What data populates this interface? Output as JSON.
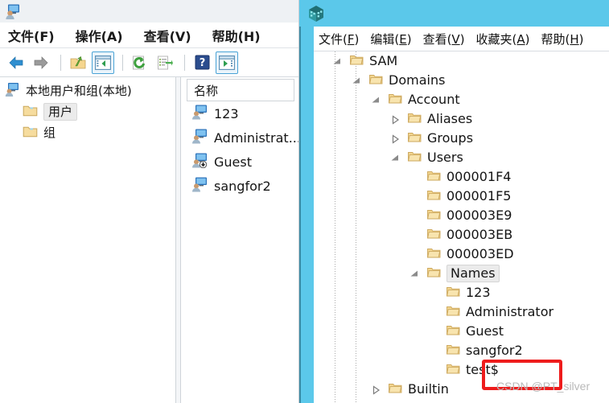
{
  "left_window": {
    "app_icon": "local-users-groups-icon",
    "menu": [
      {
        "label": "文件(F)"
      },
      {
        "label": "操作(A)"
      },
      {
        "label": "查看(V)"
      },
      {
        "label": "帮助(H)"
      }
    ],
    "toolbar": [
      {
        "name": "back-button",
        "icon": "left-arrow-icon"
      },
      {
        "name": "forward-button",
        "icon": "right-arrow-icon"
      },
      {
        "name": "up-folder-button",
        "icon": "up-folder-icon"
      },
      {
        "name": "show-hide-tree-button",
        "icon": "console-tree-icon"
      },
      {
        "name": "refresh-button",
        "icon": "refresh-icon"
      },
      {
        "name": "export-list-button",
        "icon": "export-list-icon"
      },
      {
        "name": "help-button",
        "icon": "help-question-icon"
      },
      {
        "name": "show-action-pane-button",
        "icon": "action-pane-icon"
      }
    ],
    "tree": {
      "root": {
        "label": "本地用户和组(本地)",
        "icon": "computer-user-icon"
      },
      "children": [
        {
          "label": "用户",
          "icon": "folder-icon",
          "selected": true
        },
        {
          "label": "组",
          "icon": "folder-icon",
          "selected": false
        }
      ]
    },
    "list": {
      "column_header": "名称",
      "rows": [
        {
          "name": "123",
          "icon": "user-icon"
        },
        {
          "name": "Administrat...",
          "icon": "user-icon"
        },
        {
          "name": "Guest",
          "icon": "user-disabled-icon"
        },
        {
          "name": "sangfor2",
          "icon": "user-icon"
        }
      ]
    }
  },
  "right_window": {
    "app_icon": "regedit-icon",
    "titlebar_color": "#5bc8ea",
    "menu": [
      {
        "label": "文件",
        "accel": "F"
      },
      {
        "label": "编辑",
        "accel": "E"
      },
      {
        "label": "查看",
        "accel": "V"
      },
      {
        "label": "收藏夹",
        "accel": "A"
      },
      {
        "label": "帮助",
        "accel": "H"
      }
    ],
    "tree": [
      {
        "label": "SAM",
        "depth": 1,
        "state": "expanded",
        "selected": false
      },
      {
        "label": "Domains",
        "depth": 2,
        "state": "expanded",
        "selected": false
      },
      {
        "label": "Account",
        "depth": 3,
        "state": "expanded",
        "selected": false
      },
      {
        "label": "Aliases",
        "depth": 4,
        "state": "collapsed",
        "selected": false
      },
      {
        "label": "Groups",
        "depth": 4,
        "state": "collapsed",
        "selected": false
      },
      {
        "label": "Users",
        "depth": 4,
        "state": "expanded",
        "selected": false
      },
      {
        "label": "000001F4",
        "depth": 5,
        "state": "leaf",
        "selected": false
      },
      {
        "label": "000001F5",
        "depth": 5,
        "state": "leaf",
        "selected": false
      },
      {
        "label": "000003E9",
        "depth": 5,
        "state": "leaf",
        "selected": false
      },
      {
        "label": "000003EB",
        "depth": 5,
        "state": "leaf",
        "selected": false
      },
      {
        "label": "000003ED",
        "depth": 5,
        "state": "leaf",
        "selected": false
      },
      {
        "label": "Names",
        "depth": 5,
        "state": "expanded",
        "selected": true
      },
      {
        "label": "123",
        "depth": 6,
        "state": "leaf",
        "selected": false
      },
      {
        "label": "Administrator",
        "depth": 6,
        "state": "leaf",
        "selected": false
      },
      {
        "label": "Guest",
        "depth": 6,
        "state": "leaf",
        "selected": false
      },
      {
        "label": "sangfor2",
        "depth": 6,
        "state": "leaf",
        "selected": false
      },
      {
        "label": "test$",
        "depth": 6,
        "state": "leaf",
        "selected": false
      },
      {
        "label": "Builtin",
        "depth": 3,
        "state": "collapsed",
        "selected": false
      }
    ]
  },
  "annotation": {
    "highlight_target": "test$",
    "highlight_color": "#ee1c1c",
    "watermark": "CSDN @PT_silver"
  }
}
